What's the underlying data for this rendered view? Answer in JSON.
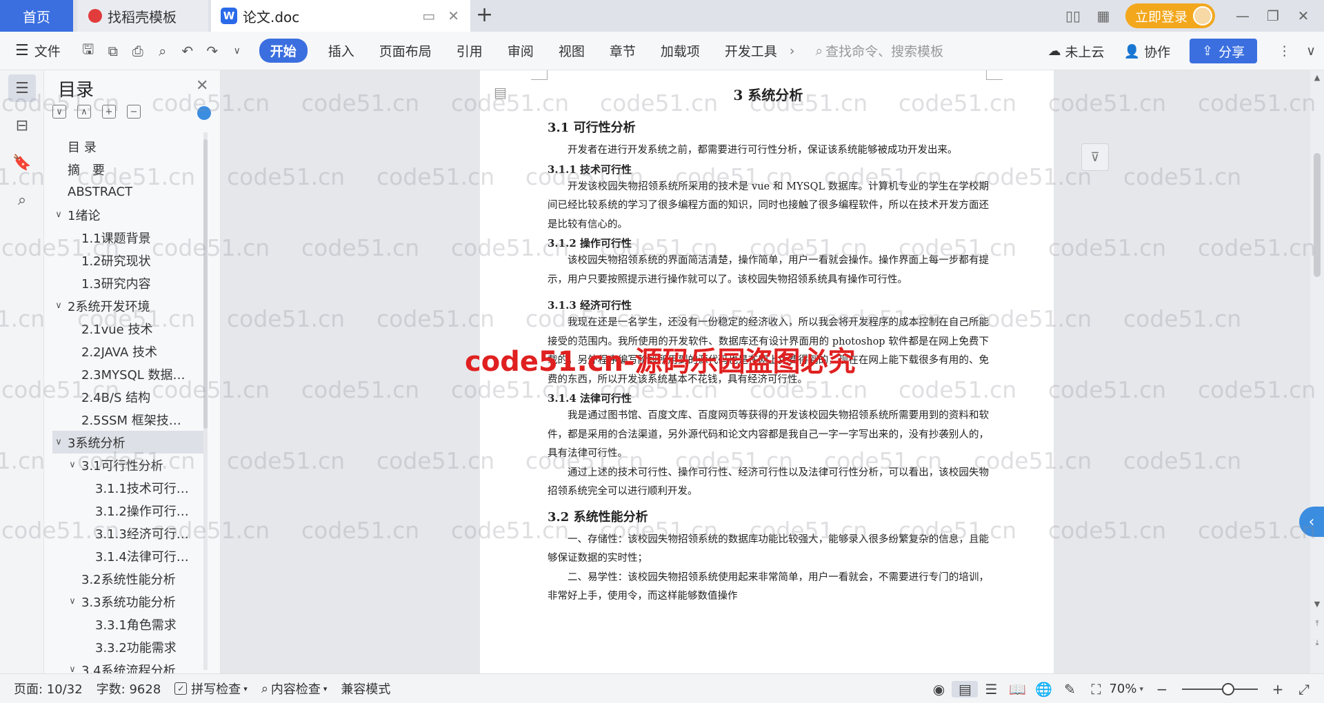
{
  "tabs": {
    "home": "首页",
    "template": "找稻壳模板",
    "doc": "论文.doc"
  },
  "login": "立即登录",
  "ribbon": {
    "file": "文件",
    "tabs": [
      "开始",
      "插入",
      "页面布局",
      "引用",
      "审阅",
      "视图",
      "章节",
      "加载项",
      "开发工具"
    ],
    "search_placeholder": "查找命令、搜索模板",
    "cloud": "未上云",
    "collab": "协作",
    "share": "分享"
  },
  "toc": {
    "title": "目录",
    "items": [
      {
        "level": 1,
        "label": "目 录",
        "caret": ""
      },
      {
        "level": 1,
        "label": "摘　要",
        "caret": ""
      },
      {
        "level": 1,
        "label": "ABSTRACT",
        "caret": ""
      },
      {
        "level": 1,
        "label": "1绪论",
        "caret": "∨"
      },
      {
        "level": 2,
        "label": "1.1课题背景",
        "caret": ""
      },
      {
        "level": 2,
        "label": "1.2研究现状",
        "caret": ""
      },
      {
        "level": 2,
        "label": "1.3研究内容",
        "caret": ""
      },
      {
        "level": 1,
        "label": "2系统开发环境",
        "caret": "∨"
      },
      {
        "level": 2,
        "label": "2.1vue 技术",
        "caret": ""
      },
      {
        "level": 2,
        "label": "2.2JAVA 技术",
        "caret": ""
      },
      {
        "level": 2,
        "label": "2.3MYSQL 数据…",
        "caret": ""
      },
      {
        "level": 2,
        "label": "2.4B/S 结构",
        "caret": ""
      },
      {
        "level": 2,
        "label": "2.5SSM 框架技…",
        "caret": ""
      },
      {
        "level": 1,
        "label": "3系统分析",
        "caret": "∨",
        "selected": true
      },
      {
        "level": 2,
        "label": "3.1可行性分析",
        "caret": "∨"
      },
      {
        "level": 3,
        "label": "3.1.1技术可行…",
        "caret": ""
      },
      {
        "level": 3,
        "label": "3.1.2操作可行…",
        "caret": ""
      },
      {
        "level": 3,
        "label": "3.1.3经济可行…",
        "caret": ""
      },
      {
        "level": 3,
        "label": "3.1.4法律可行…",
        "caret": ""
      },
      {
        "level": 2,
        "label": "3.2系统性能分析",
        "caret": ""
      },
      {
        "level": 2,
        "label": "3.3系统功能分析",
        "caret": "∨"
      },
      {
        "level": 3,
        "label": "3.3.1角色需求",
        "caret": ""
      },
      {
        "level": 3,
        "label": "3.3.2功能需求",
        "caret": ""
      },
      {
        "level": 2,
        "label": "3.4系统流程分析",
        "caret": "∨"
      }
    ]
  },
  "doc": {
    "chapter_title": "3  系统分析",
    "s31": "3.1  可行性分析",
    "p31": "开发者在进行开发系统之前，都需要进行可行性分析，保证该系统能够被成功开发出来。",
    "s311": "3.1.1  技术可行性",
    "p311": "开发该校园失物招领系统所采用的技术是 vue 和 MYSQL 数据库。计算机专业的学生在学校期间已经比较系统的学习了很多编程方面的知识，同时也接触了很多编程软件，所以在技术开发方面还是比较有信心的。",
    "s312": "3.1.2  操作可行性",
    "p312": "该校园失物招领系统的界面简洁清楚，操作简单，用户一看就会操作。操作界面上每一步都有提示，用户只要按照提示进行操作就可以了。该校园失物招领系统具有操作可行性。",
    "s313": "3.1.3  经济可行性",
    "p313": "我现在还是一名学生，还没有一份稳定的经济收入，所以我会将开发程序的成本控制在自己所能接受的范围内。我所使用的开发软件、数据库还有设计界面用的 photoshop 软件都是在网上免费下载的，另外程序编写阶段所用到的源代码也是在网上免费得到的，现在在网上能下载很多有用的、免费的东西，所以开发该系统基本不花钱，具有经济可行性。",
    "s314": "3.1.4  法律可行性",
    "p314": "我是通过图书馆、百度文库、百度网页等获得的开发该校园失物招领系统所需要用到的资料和软件，都是采用的合法渠道，另外源代码和论文内容都是我自己一字一字写出来的，没有抄袭别人的，具有法律可行性。",
    "p314b": "通过上述的技术可行性、操作可行性、经济可行性以及法律可行性分析，可以看出，该校园失物招领系统完全可以进行顺利开发。",
    "s32": "3.2  系统性能分析",
    "p32a": "一、存储性：该校园失物招领系统的数据库功能比较强大，能够录入很多纷繁复杂的信息，且能够保证数据的实时性；",
    "p32b": "二、易学性：该校园失物招领系统使用起来非常简单，用户一看就会，不需要进行专门的培训，非常好上手，使用令，而这样能够数值操作"
  },
  "watermark": "code51.cn",
  "big_watermark": "code51.cn-源码乐园盗图必究",
  "status": {
    "page": "页面: 10/32",
    "words": "字数: 9628",
    "spell": "拼写检查",
    "content": "内容检查",
    "compat": "兼容模式",
    "zoom": "70%"
  },
  "colors": {
    "accent": "#3b6fe0",
    "login": "#f2a71c",
    "big_watermark": "#e02020"
  }
}
